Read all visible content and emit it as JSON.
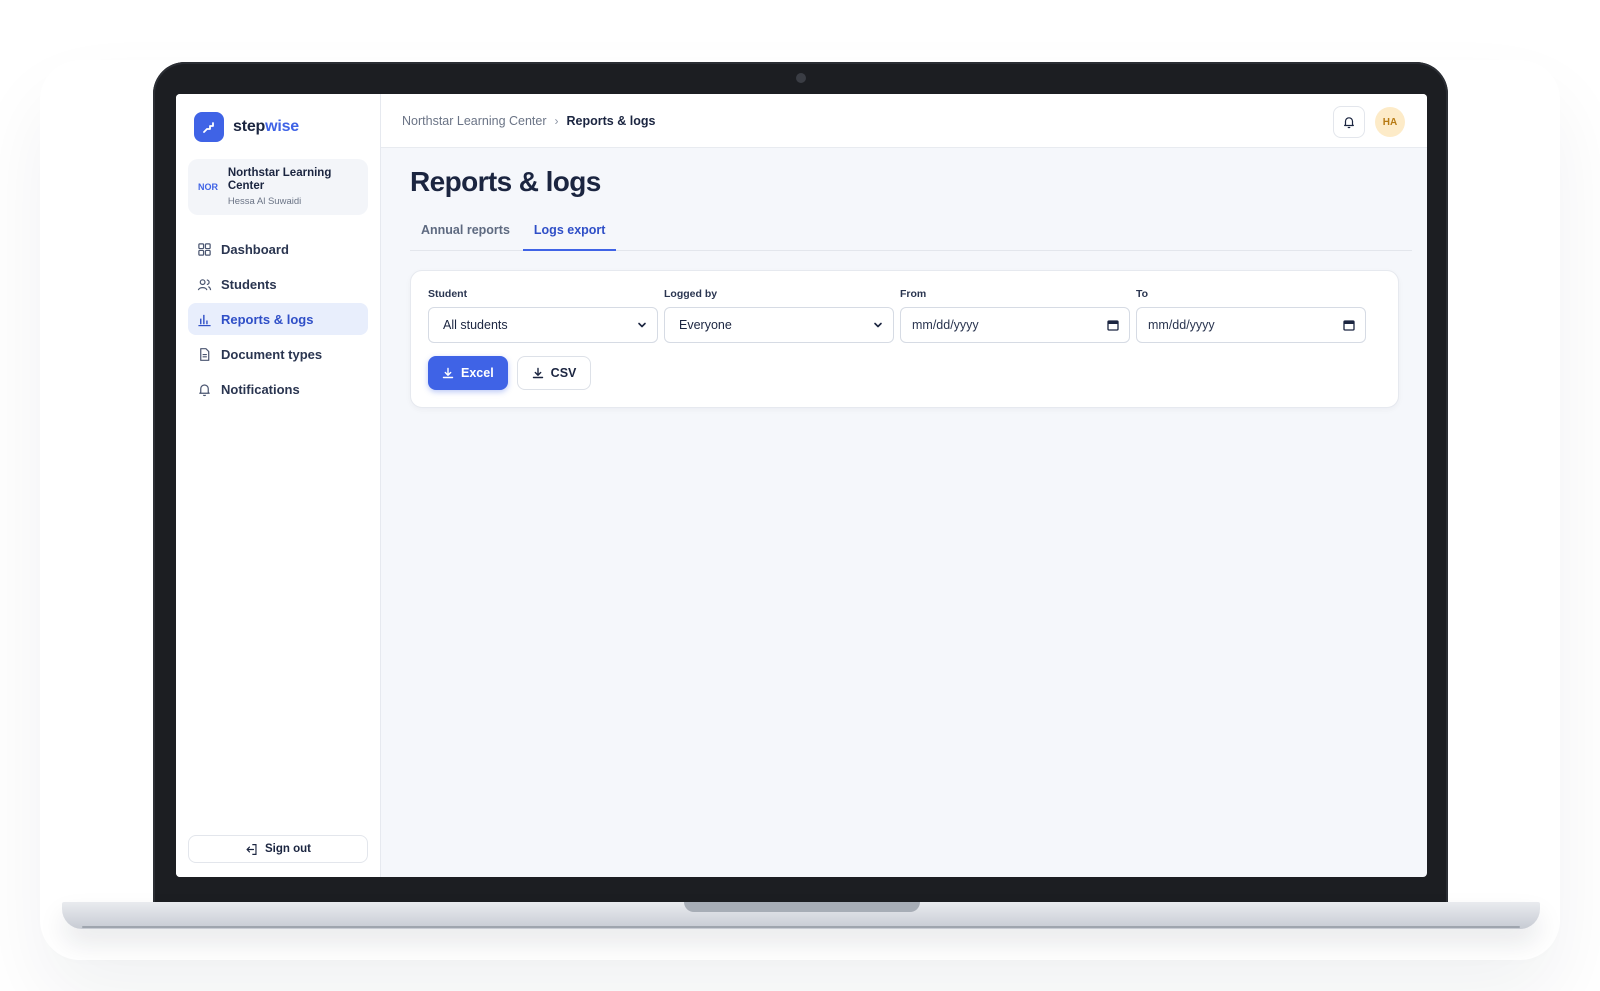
{
  "brand": {
    "name_main": "step",
    "name_accent": "wise"
  },
  "org": {
    "abbr": "NOR",
    "name": "Northstar Learning Center",
    "user": "Hessa Al Suwaidi"
  },
  "sidebar": {
    "items": [
      {
        "label": "Dashboard",
        "icon": "grid-icon",
        "active": false
      },
      {
        "label": "Students",
        "icon": "users-icon",
        "active": false
      },
      {
        "label": "Reports & logs",
        "icon": "bar-chart-icon",
        "active": true
      },
      {
        "label": "Document types",
        "icon": "document-icon",
        "active": false
      },
      {
        "label": "Notifications",
        "icon": "bell-icon",
        "active": false
      }
    ],
    "signout_label": "Sign out"
  },
  "topbar": {
    "breadcrumb": [
      "Northstar Learning Center",
      "Reports & logs"
    ],
    "breadcrumb_separator": "›",
    "avatar_initials": "HA"
  },
  "main": {
    "title": "Reports & logs",
    "tabs": [
      {
        "label": "Annual reports",
        "active": false
      },
      {
        "label": "Logs export",
        "active": true
      }
    ],
    "filters": {
      "student": {
        "label": "Student",
        "value": "All students"
      },
      "logged_by": {
        "label": "Logged by",
        "value": "Everyone"
      },
      "from": {
        "label": "From",
        "placeholder": "mm/dd/yyyy"
      },
      "to": {
        "label": "To",
        "placeholder": "mm/dd/yyyy"
      }
    },
    "export_buttons": {
      "excel": "Excel",
      "csv": "CSV"
    }
  },
  "colors": {
    "accent": "#3f63e6",
    "active_bg": "#e8eefc",
    "avatar_bg": "#fdebc8"
  }
}
